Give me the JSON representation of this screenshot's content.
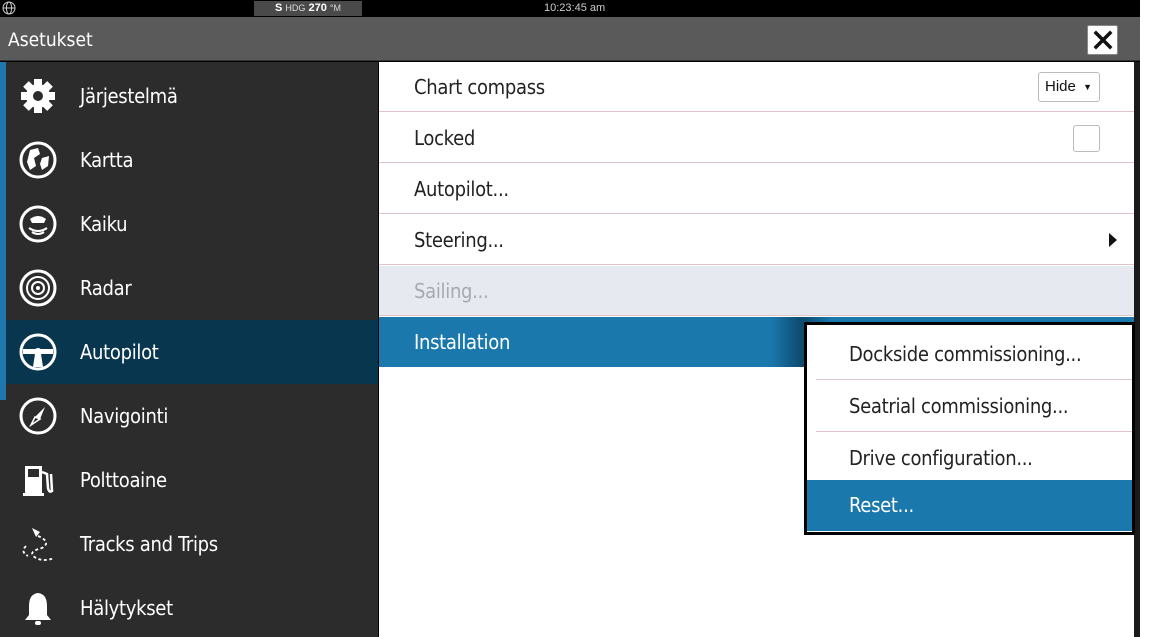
{
  "status_bar": {
    "hdg_prefix": "S",
    "hdg_label": "HDG",
    "hdg_value": "270",
    "hdg_unit": "°M",
    "time": "10:23:45 am"
  },
  "title_bar": {
    "title": "Asetukset",
    "close_icon": "close-icon"
  },
  "sidebar": {
    "items": [
      {
        "label": "Järjestelmä",
        "icon": "gear-icon"
      },
      {
        "label": "Kartta",
        "icon": "chart-icon"
      },
      {
        "label": "Kaiku",
        "icon": "echo-icon"
      },
      {
        "label": "Radar",
        "icon": "radar-icon"
      },
      {
        "label": "Autopilot",
        "icon": "steering-wheel-icon",
        "selected": true
      },
      {
        "label": "Navigointi",
        "icon": "compass-icon"
      },
      {
        "label": "Polttoaine",
        "icon": "fuel-pump-icon"
      },
      {
        "label": "Tracks and Trips",
        "icon": "tracks-icon"
      },
      {
        "label": "Hälytykset",
        "icon": "bell-icon"
      }
    ]
  },
  "main": {
    "rows": [
      {
        "label": "Chart compass",
        "control": "dropdown",
        "value": "Hide"
      },
      {
        "label": "Locked",
        "control": "checkbox",
        "checked": false
      },
      {
        "label": "Autopilot..."
      },
      {
        "label": "Steering...",
        "control": "submenu-arrow"
      },
      {
        "label": "Sailing...",
        "disabled": true
      },
      {
        "label": "Installation",
        "selected": true
      }
    ]
  },
  "popup": {
    "items": [
      {
        "label": "Dockside commissioning..."
      },
      {
        "label": "Seatrial commissioning..."
      },
      {
        "label": "Drive configuration..."
      },
      {
        "label": "Reset...",
        "selected": true
      }
    ]
  },
  "colors": {
    "accent": "#1a78ad",
    "sidebar_bg": "#2c2c2c",
    "sidebar_selected": "#09364f",
    "title_bar": "#5a5a5a",
    "disabled_row": "#e6e9f0"
  }
}
